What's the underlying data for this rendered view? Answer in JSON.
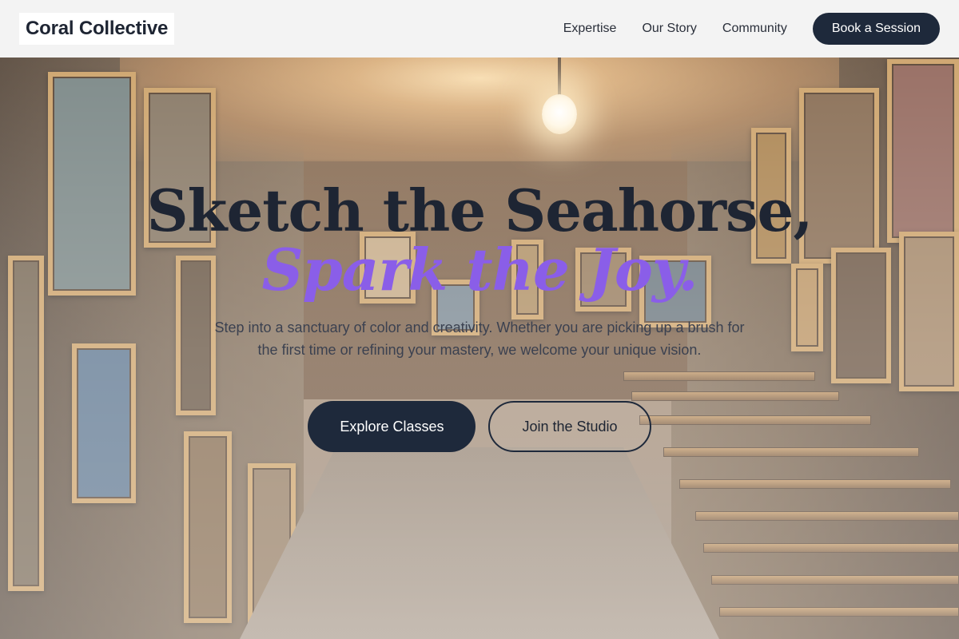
{
  "brand": {
    "name": "Coral Collective"
  },
  "nav": {
    "links": [
      "Expertise",
      "Our Story",
      "Community"
    ],
    "cta_label": "Book a Session"
  },
  "hero": {
    "headline": "Sketch the Seahorse,",
    "subheadline": "Spark the Joy.",
    "lead": "Step into a sanctuary of color and creativity. Whether you are picking up a brush for the first time or refining your mastery, we welcome your unique vision.",
    "primary_cta": "Explore Classes",
    "secondary_cta": "Join the Studio"
  },
  "colors": {
    "navy": "#1e293b",
    "accent_purple": "#8a5ee8",
    "nav_background": "#f3f3f3"
  }
}
